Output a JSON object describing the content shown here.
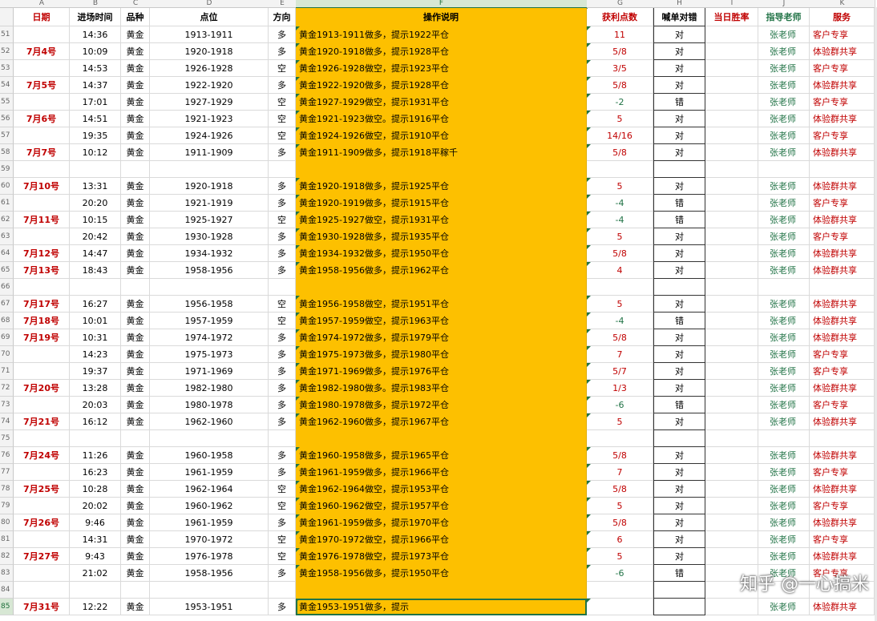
{
  "columns": [
    "A",
    "B",
    "C",
    "D",
    "E",
    "F",
    "G",
    "H",
    "I",
    "J",
    "K"
  ],
  "headers": [
    "日期",
    "进场时间",
    "品种",
    "点位",
    "方向",
    "操作说明",
    "获利点数",
    "喊单对错",
    "当日胜率",
    "指导老师",
    "服务"
  ],
  "selected_column": "F",
  "selected_row": "85",
  "watermark": "知乎 @一心搞米",
  "colors": {
    "fill": "#fdc000",
    "red": "#c00000",
    "green": "#217346"
  },
  "rows": [
    {
      "n": "51",
      "date": "",
      "time": "14:36",
      "item": "黄金",
      "pts": "1913-1911",
      "dir": "多",
      "desc": "黄金1913-1911做多，提示1922平仓",
      "profit": "11",
      "pc": "red",
      "call": "对",
      "teacher": "张老师",
      "svc": "客户专享"
    },
    {
      "n": "52",
      "date": "7月4号",
      "time": "10:09",
      "item": "黄金",
      "pts": "1920-1918",
      "dir": "多",
      "desc": "黄金1920-1918做多，提示1928平仓",
      "profit": "5/8",
      "pc": "red",
      "call": "对",
      "teacher": "张老师",
      "svc": "体验群共享"
    },
    {
      "n": "53",
      "date": "",
      "time": "14:53",
      "item": "黄金",
      "pts": "1926-1928",
      "dir": "空",
      "desc": "黄金1926-1928做空，提示1923平仓",
      "profit": "3/5",
      "pc": "red",
      "call": "对",
      "teacher": "张老师",
      "svc": "客户专享"
    },
    {
      "n": "54",
      "date": "7月5号",
      "time": "14:37",
      "item": "黄金",
      "pts": "1922-1920",
      "dir": "多",
      "desc": "黄金1922-1920做多，提示1928平仓",
      "profit": "5/8",
      "pc": "red",
      "call": "对",
      "teacher": "张老师",
      "svc": "体验群共享"
    },
    {
      "n": "55",
      "date": "",
      "time": "17:01",
      "item": "黄金",
      "pts": "1927-1929",
      "dir": "空",
      "desc": "黄金1927-1929做空，提示1931平仓",
      "profit": "-2",
      "pc": "green",
      "call": "错",
      "teacher": "张老师",
      "svc": "客户专享"
    },
    {
      "n": "56",
      "date": "7月6号",
      "time": "14:51",
      "item": "黄金",
      "pts": "1921-1923",
      "dir": "空",
      "desc": "黄金1921-1923做空。提示1916平仓",
      "profit": "5",
      "pc": "red",
      "call": "对",
      "teacher": "张老师",
      "svc": "体验群共享"
    },
    {
      "n": "57",
      "date": "",
      "time": "19:35",
      "item": "黄金",
      "pts": "1924-1926",
      "dir": "空",
      "desc": "黄金1924-1926做空，提示1910平仓",
      "profit": "14/16",
      "pc": "red",
      "call": "对",
      "teacher": "张老师",
      "svc": "客户专享"
    },
    {
      "n": "58",
      "date": "7月7号",
      "time": "10:12",
      "item": "黄金",
      "pts": "1911-1909",
      "dir": "多",
      "desc": "黄金1911-1909做多，提示1918平稼千",
      "profit": "5/8",
      "pc": "red",
      "call": "对",
      "teacher": "张老师",
      "svc": "体验群共享"
    },
    {
      "n": "59",
      "date": "",
      "time": "",
      "item": "",
      "pts": "",
      "dir": "",
      "desc": "",
      "profit": "",
      "pc": "red",
      "call": "",
      "teacher": "",
      "svc": ""
    },
    {
      "n": "60",
      "date": "7月10号",
      "time": "13:31",
      "item": "黄金",
      "pts": "1920-1918",
      "dir": "多",
      "desc": "黄金1920-1918做多，提示1925平仓",
      "profit": "5",
      "pc": "red",
      "call": "对",
      "teacher": "张老师",
      "svc": "体验群共享"
    },
    {
      "n": "61",
      "date": "",
      "time": "20:20",
      "item": "黄金",
      "pts": "1921-1919",
      "dir": "多",
      "desc": "黄金1920-1919做多，提示1915平仓",
      "profit": "-4",
      "pc": "green",
      "call": "错",
      "teacher": "张老师",
      "svc": "客户专享"
    },
    {
      "n": "62",
      "date": "7月11号",
      "time": "10:15",
      "item": "黄金",
      "pts": "1925-1927",
      "dir": "空",
      "desc": "黄金1925-1927做空，提示1931平仓",
      "profit": "-4",
      "pc": "green",
      "call": "错",
      "teacher": "张老师",
      "svc": "体验群共享"
    },
    {
      "n": "63",
      "date": "",
      "time": "20:42",
      "item": "黄金",
      "pts": "1930-1928",
      "dir": "多",
      "desc": "黄金1930-1928做多，提示1935平仓",
      "profit": "5",
      "pc": "red",
      "call": "对",
      "teacher": "张老师",
      "svc": "客户专享"
    },
    {
      "n": "64",
      "date": "7月12号",
      "time": "14:47",
      "item": "黄金",
      "pts": "1934-1932",
      "dir": "多",
      "desc": "黄金1934-1932做多，提示1950平仓",
      "profit": "5/8",
      "pc": "red",
      "call": "对",
      "teacher": "张老师",
      "svc": "体验群共享"
    },
    {
      "n": "65",
      "date": "7月13号",
      "time": "18:43",
      "item": "黄金",
      "pts": "1958-1956",
      "dir": "多",
      "desc": "黄金1958-1956做多，提示1962平仓",
      "profit": "4",
      "pc": "red",
      "call": "对",
      "teacher": "张老师",
      "svc": "体验群共享"
    },
    {
      "n": "66",
      "date": "",
      "time": "",
      "item": "",
      "pts": "",
      "dir": "",
      "desc": "",
      "profit": "",
      "pc": "red",
      "call": "",
      "teacher": "",
      "svc": ""
    },
    {
      "n": "67",
      "date": "7月17号",
      "time": "16:27",
      "item": "黄金",
      "pts": "1956-1958",
      "dir": "空",
      "desc": "黄金1956-1958做空，提示1951平仓",
      "profit": "5",
      "pc": "red",
      "call": "对",
      "teacher": "张老师",
      "svc": "体验群共享"
    },
    {
      "n": "68",
      "date": "7月18号",
      "time": "10:01",
      "item": "黄金",
      "pts": "1957-1959",
      "dir": "空",
      "desc": "黄金1957-1959做空，提示1963平仓",
      "profit": "-4",
      "pc": "green",
      "call": "错",
      "teacher": "张老师",
      "svc": "体验群共享"
    },
    {
      "n": "69",
      "date": "7月19号",
      "time": "10:31",
      "item": "黄金",
      "pts": "1974-1972",
      "dir": "多",
      "desc": "黄金1974-1972做多，提示1979平仓",
      "profit": "5/8",
      "pc": "red",
      "call": "对",
      "teacher": "张老师",
      "svc": "体验群共享"
    },
    {
      "n": "70",
      "date": "",
      "time": "14:23",
      "item": "黄金",
      "pts": "1975-1973",
      "dir": "多",
      "desc": "黄金1975-1973做多，提示1980平仓",
      "profit": "7",
      "pc": "red",
      "call": "对",
      "teacher": "张老师",
      "svc": "客户专享"
    },
    {
      "n": "71",
      "date": "",
      "time": "19:37",
      "item": "黄金",
      "pts": "1971-1969",
      "dir": "多",
      "desc": "黄金1971-1969做多，提示1976平仓",
      "profit": "5/7",
      "pc": "red",
      "call": "对",
      "teacher": "张老师",
      "svc": "客户专享"
    },
    {
      "n": "72",
      "date": "7月20号",
      "time": "13:28",
      "item": "黄金",
      "pts": "1982-1980",
      "dir": "多",
      "desc": "黄金1982-1980做多。提示1983平仓",
      "profit": "1/3",
      "pc": "red",
      "call": "对",
      "teacher": "张老师",
      "svc": "体验群共享"
    },
    {
      "n": "73",
      "date": "",
      "time": "20:03",
      "item": "黄金",
      "pts": "1980-1978",
      "dir": "多",
      "desc": "黄金1980-1978做多，提示1972平仓",
      "profit": "-6",
      "pc": "green",
      "call": "错",
      "teacher": "张老师",
      "svc": "客户专享"
    },
    {
      "n": "74",
      "date": "7月21号",
      "time": "16:12",
      "item": "黄金",
      "pts": "1962-1960",
      "dir": "多",
      "desc": "黄金1962-1960做多，提示1967平仓",
      "profit": "5",
      "pc": "red",
      "call": "对",
      "teacher": "张老师",
      "svc": "体验群共享"
    },
    {
      "n": "75",
      "date": "",
      "time": "",
      "item": "",
      "pts": "",
      "dir": "",
      "desc": "",
      "profit": "",
      "pc": "red",
      "call": "",
      "teacher": "",
      "svc": ""
    },
    {
      "n": "76",
      "date": "7月24号",
      "time": "11:26",
      "item": "黄金",
      "pts": "1960-1958",
      "dir": "多",
      "desc": "黄金1960-1958做多，提示1965平仓",
      "profit": "5/8",
      "pc": "red",
      "call": "对",
      "teacher": "张老师",
      "svc": "体验群共享"
    },
    {
      "n": "77",
      "date": "",
      "time": "16:23",
      "item": "黄金",
      "pts": "1961-1959",
      "dir": "多",
      "desc": "黄金1961-1959做多，提示1966平仓",
      "profit": "7",
      "pc": "red",
      "call": "对",
      "teacher": "张老师",
      "svc": "客户专享"
    },
    {
      "n": "78",
      "date": "7月25号",
      "time": "10:28",
      "item": "黄金",
      "pts": "1962-1964",
      "dir": "空",
      "desc": "黄金1962-1964做空，提示1953平仓",
      "profit": "5/8",
      "pc": "red",
      "call": "对",
      "teacher": "张老师",
      "svc": "体验群共享"
    },
    {
      "n": "79",
      "date": "",
      "time": "20:02",
      "item": "黄金",
      "pts": "1960-1962",
      "dir": "空",
      "desc": "黄金1960-1962做空，提示1957平仓",
      "profit": "5",
      "pc": "red",
      "call": "对",
      "teacher": "张老师",
      "svc": "客户专享"
    },
    {
      "n": "80",
      "date": "7月26号",
      "time": "9:46",
      "item": "黄金",
      "pts": "1961-1959",
      "dir": "多",
      "desc": "黄金1961-1959做多，提示1970平仓",
      "profit": "5/8",
      "pc": "red",
      "call": "对",
      "teacher": "张老师",
      "svc": "体验群共享"
    },
    {
      "n": "81",
      "date": "",
      "time": "14:31",
      "item": "黄金",
      "pts": "1970-1972",
      "dir": "空",
      "desc": "黄金1970-1972做空，提示1966平仓",
      "profit": "6",
      "pc": "red",
      "call": "对",
      "teacher": "张老师",
      "svc": "客户专享"
    },
    {
      "n": "82",
      "date": "7月27号",
      "time": "9:43",
      "item": "黄金",
      "pts": "1976-1978",
      "dir": "空",
      "desc": "黄金1976-1978做空，提示1973平仓",
      "profit": "5",
      "pc": "red",
      "call": "对",
      "teacher": "张老师",
      "svc": "体验群共享"
    },
    {
      "n": "83",
      "date": "",
      "time": "21:02",
      "item": "黄金",
      "pts": "1958-1956",
      "dir": "多",
      "desc": "黄金1958-1956做多，提示1950平仓",
      "profit": "-6",
      "pc": "green",
      "call": "错",
      "teacher": "张老师",
      "svc": "客户专享"
    },
    {
      "n": "84",
      "date": "",
      "time": "",
      "item": "",
      "pts": "",
      "dir": "",
      "desc": "",
      "profit": "",
      "pc": "red",
      "call": "",
      "teacher": "",
      "svc": ""
    },
    {
      "n": "85",
      "date": "7月31号",
      "time": "12:22",
      "item": "黄金",
      "pts": "1953-1951",
      "dir": "多",
      "desc": "黄金1953-1951做多，提示",
      "profit": "",
      "pc": "red",
      "call": "",
      "teacher": "张老师",
      "svc": "体验群共享"
    }
  ]
}
